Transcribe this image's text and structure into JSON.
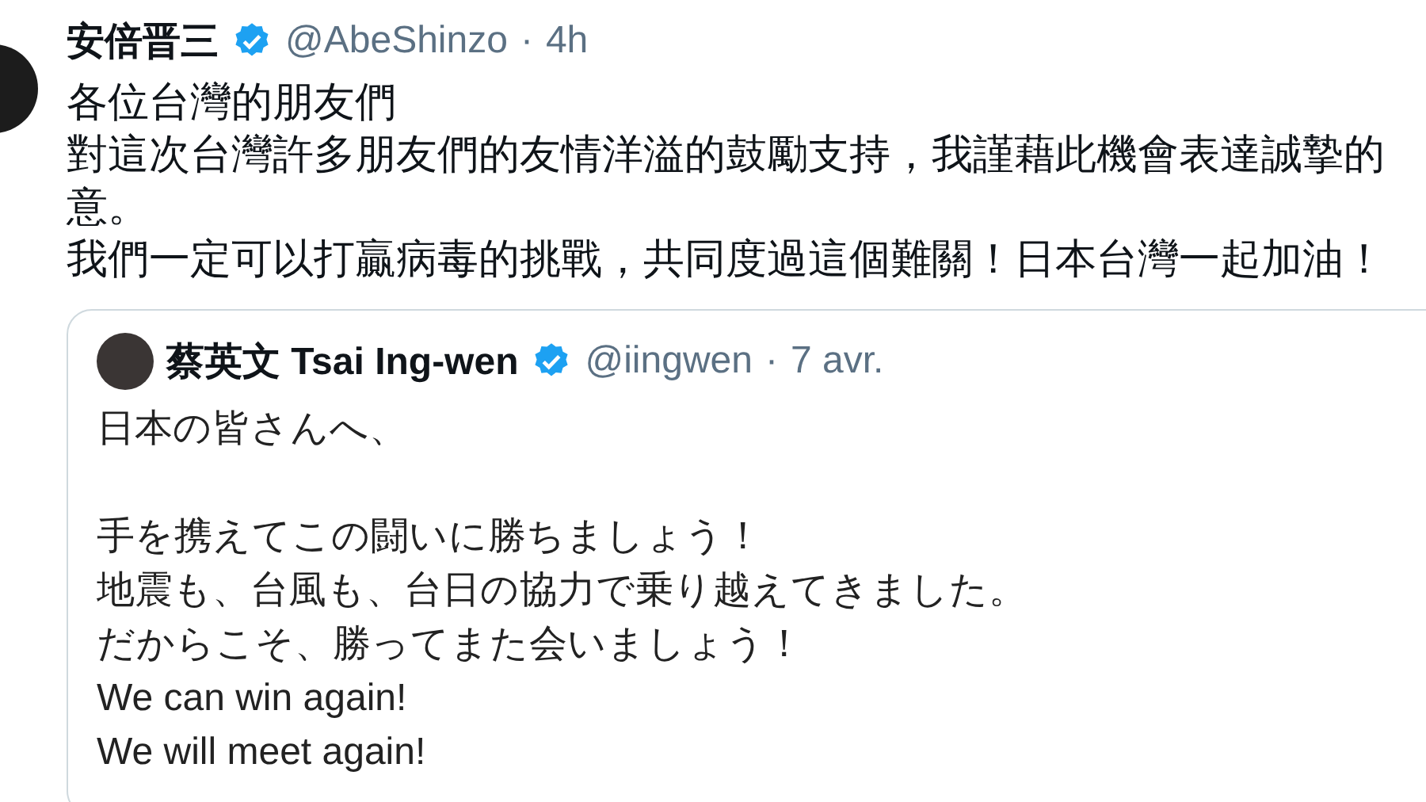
{
  "tweet": {
    "author": {
      "name": "安倍晋三",
      "verified": true,
      "handle": "@AbeShinzo",
      "separator": "·",
      "time": "4h"
    },
    "lines": [
      "各位台灣的朋友們",
      "對這次台灣許多朋友們的友情洋溢的鼓勵支持，我謹藉此機會表達誠摯的",
      "意。",
      "我們一定可以打贏病毒的挑戰，共同度過這個難關！日本台灣一起加油！"
    ],
    "quoted_tweet": {
      "author": {
        "name": "蔡英文 Tsai Ing-wen",
        "verified": true,
        "handle": "@iingwen",
        "separator": "·",
        "time": "7 avr."
      },
      "paragraphs": [
        [
          "日本の皆さんへ、"
        ],
        [
          "手を携えてこの闘いに勝ちましょう！",
          "地震も、台風も、台日の協力で乗り越えてきました。",
          "だからこそ、勝ってまた会いましょう！",
          "We can win again!",
          "We will meet again!"
        ]
      ]
    }
  }
}
